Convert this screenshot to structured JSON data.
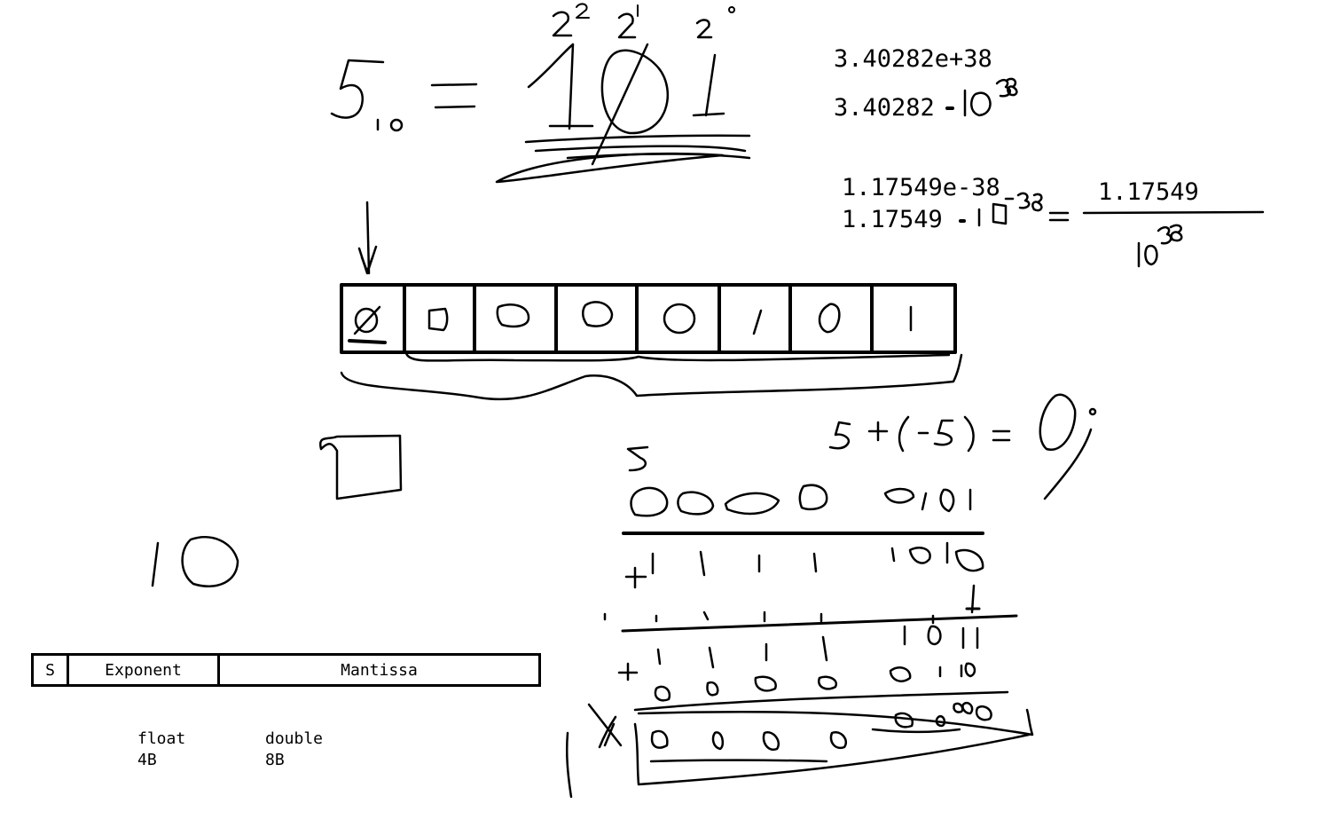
{
  "whiteboard": {
    "drawing_color": "#000000",
    "background_color": "#ffffff",
    "notes": {
      "float_max": "3.40282e+38",
      "float_max_expanded": "3.40282",
      "float_min": "1.17549e-38",
      "float_min_expanded": "1.17549",
      "fraction_numerator": "1.17549"
    },
    "layout_box": {
      "sign_label": "S",
      "exponent_label": "Exponent",
      "mantissa_label": "Mantissa"
    },
    "types": {
      "float_label": "float",
      "float_size": "4B",
      "double_label": "double",
      "double_size": "8B"
    }
  }
}
